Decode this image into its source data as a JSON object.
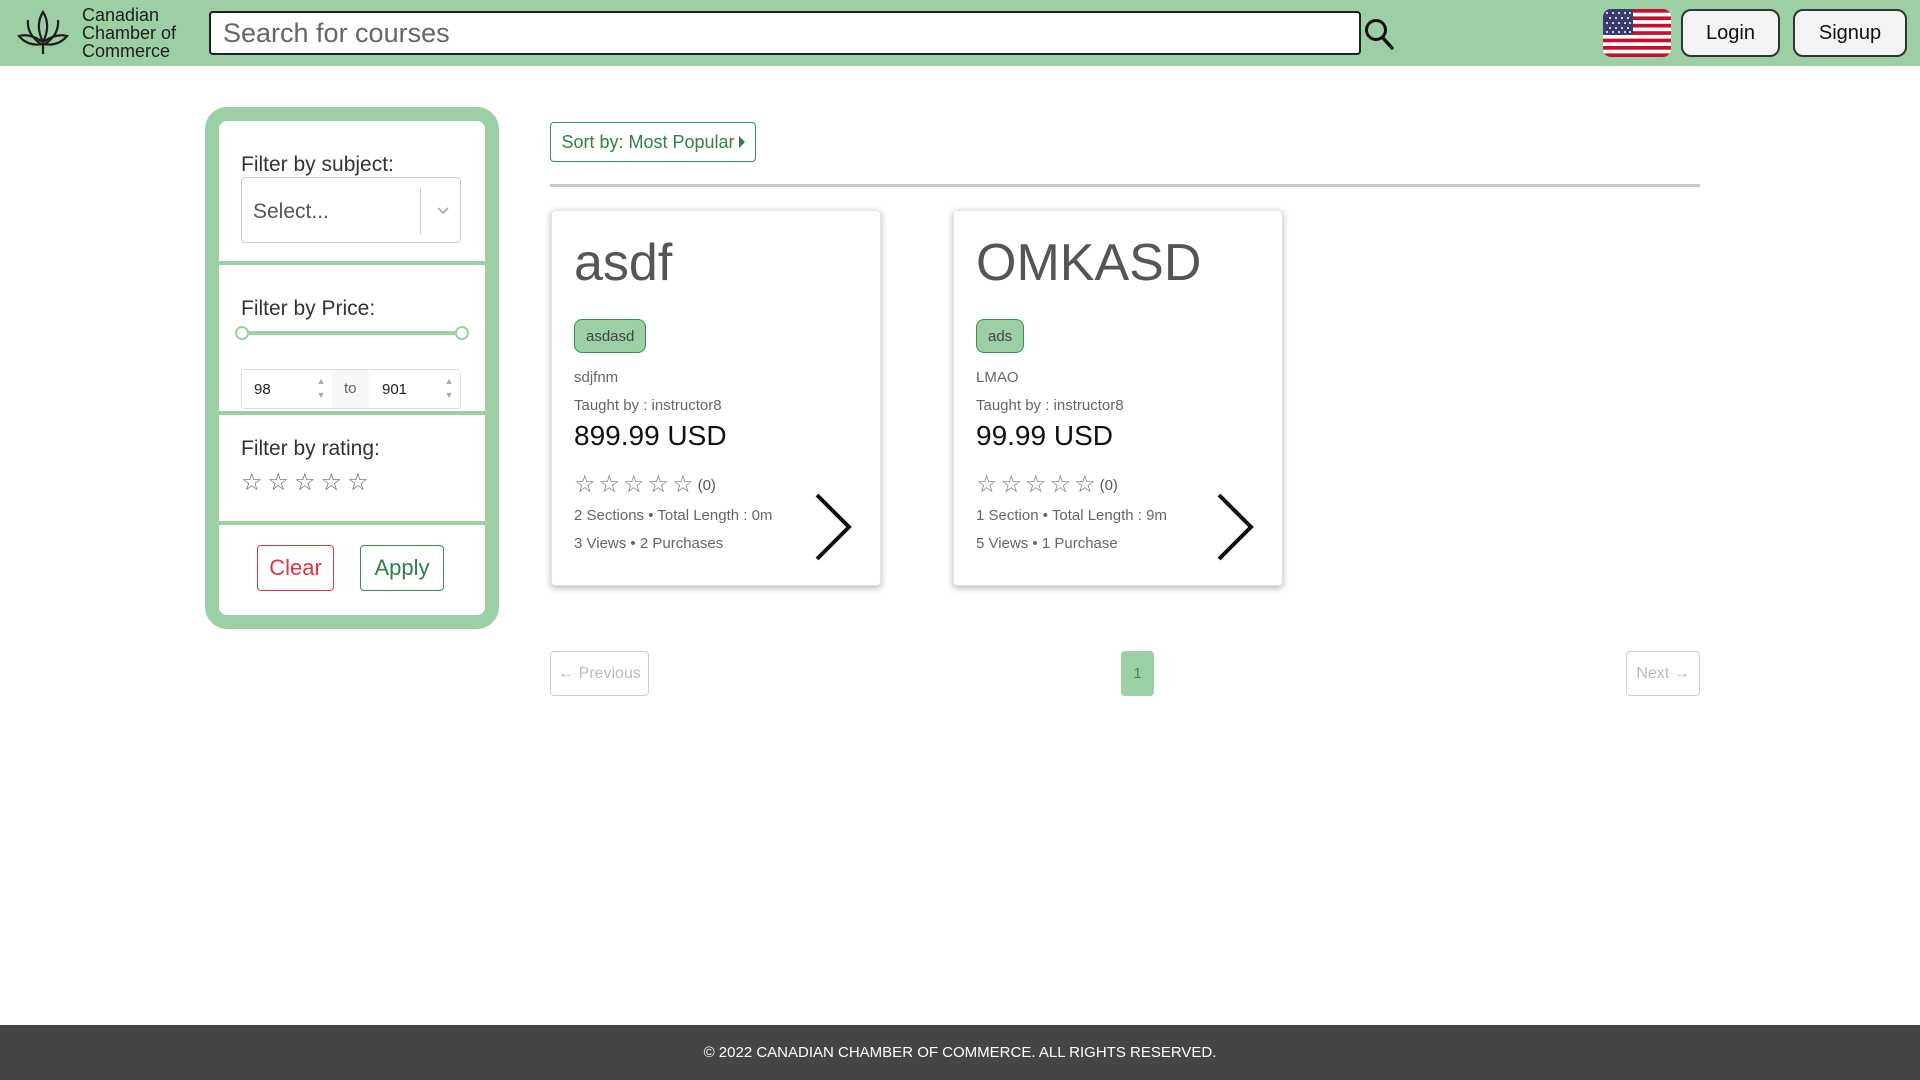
{
  "header": {
    "logo_line1": "Canadian",
    "logo_line2": "Chamber of",
    "logo_line3": "Commerce",
    "search_placeholder": "Search for courses",
    "login_label": "Login",
    "signup_label": "Signup",
    "language_icon": "us-flag-icon",
    "search_icon": "search-icon"
  },
  "filters": {
    "subject_title": "Filter by subject:",
    "subject_value": "Select...",
    "price_title": "Filter by Price:",
    "price_min": "98",
    "price_max": "901",
    "price_to": "to",
    "rating_title": "Filter by rating:",
    "rating_stars": [
      "☆",
      "☆",
      "☆",
      "☆",
      "☆"
    ],
    "clear_label": "Clear",
    "apply_label": "Apply"
  },
  "sort": {
    "label": "Sort by: Most Popular"
  },
  "courses": [
    {
      "title": "asdf",
      "tag": "asdasd",
      "description": "sdjfnm",
      "teacher": "Taught by : instructor8",
      "price": "899.99 USD",
      "stars": [
        "☆",
        "☆",
        "☆",
        "☆",
        "☆"
      ],
      "rating_count": "(0)",
      "meta1": "2 Sections • Total Length : 0m",
      "meta2": "3 Views • 2 Purchases"
    },
    {
      "title": "OMKASD",
      "tag": "ads",
      "description": "LMAO",
      "teacher": "Taught by : instructor8",
      "price": "99.99 USD",
      "stars": [
        "☆",
        "☆",
        "☆",
        "☆",
        "☆"
      ],
      "rating_count": "(0)",
      "meta1": "1 Section • Total Length : 9m",
      "meta2": "5 Views • 1 Purchase"
    }
  ],
  "pagination": {
    "previous_label": "← Previous",
    "current_page": "1",
    "next_label": "Next →"
  },
  "footer": {
    "copyright": "© 2022 CANADIAN CHAMBER OF COMMERCE. ALL RIGHTS RESERVED."
  },
  "colors": {
    "brand_green": "#9ccfa4",
    "accent_green": "#2f7f48",
    "danger": "#dc3545",
    "footer_bg": "#454545"
  }
}
